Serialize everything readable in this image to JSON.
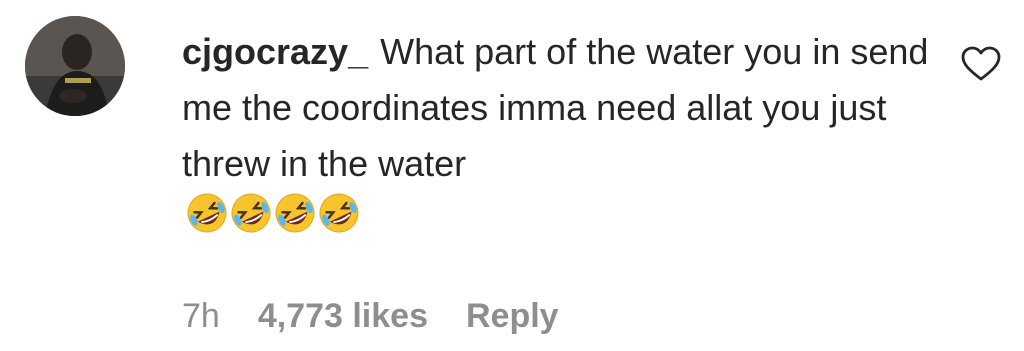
{
  "comment": {
    "username": "cjgocrazy_",
    "text": "What part of the water you in send me the coordinates imma need allat you just threw in the water",
    "emojis": [
      "🤣",
      "🤣",
      "🤣",
      "🤣"
    ],
    "time": "7h",
    "likes": "4,773 likes",
    "reply_label": "Reply"
  },
  "colors": {
    "text": "#262626",
    "secondary": "#8e8e8e",
    "emoji_face": "#f7c52b"
  },
  "icons": {
    "like": "heart-outline-icon",
    "avatar": "user-avatar"
  }
}
